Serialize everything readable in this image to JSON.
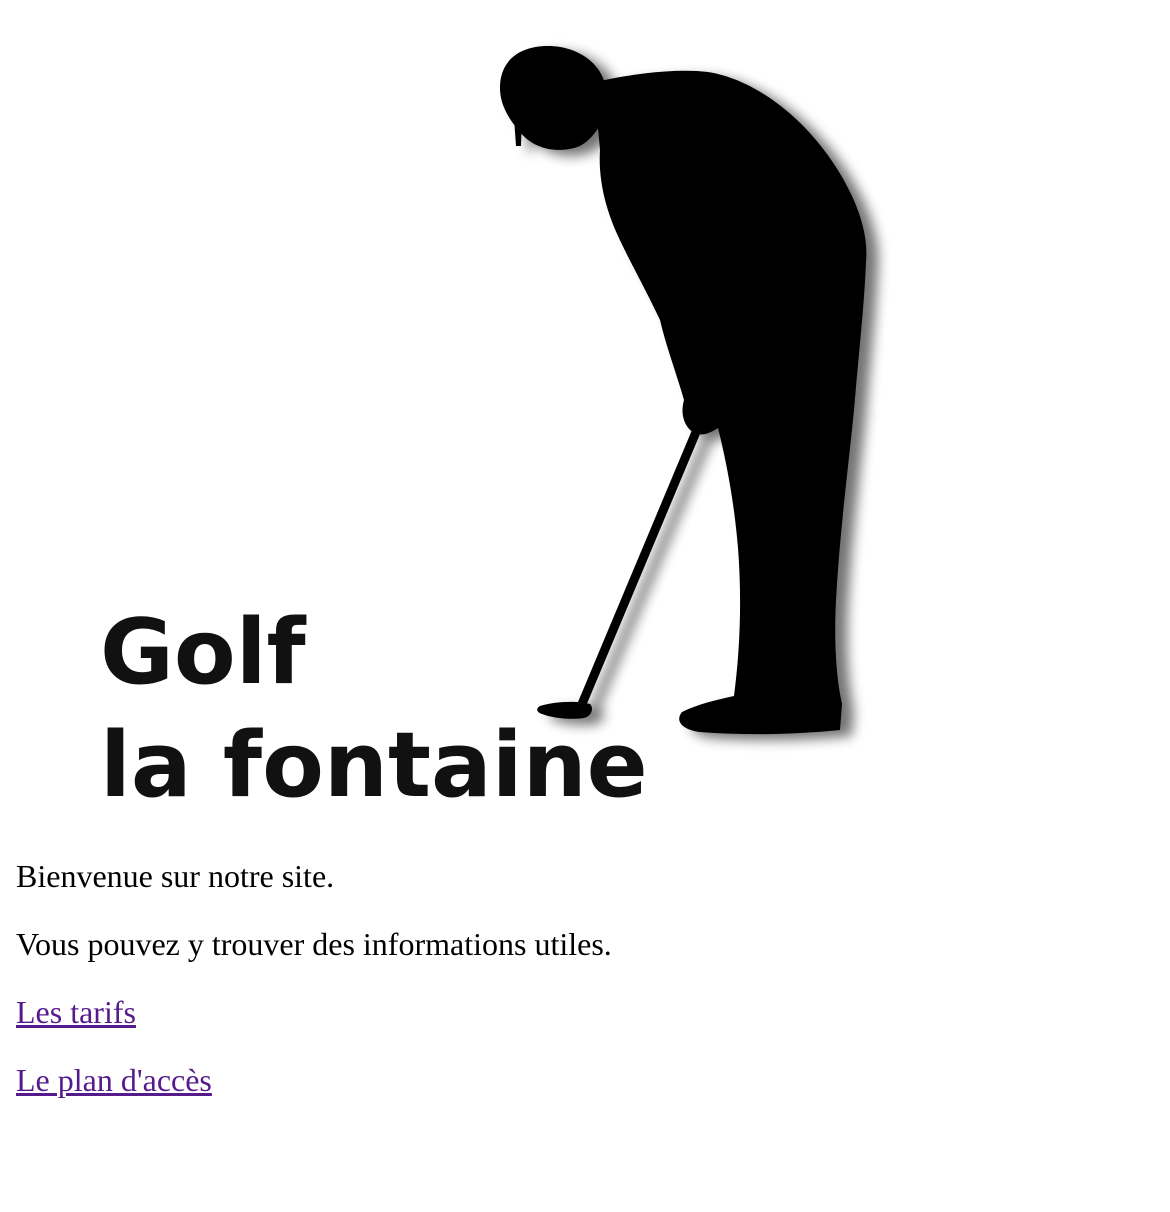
{
  "logo": {
    "line1": "Golf",
    "line2": "la fontaine",
    "icon": "golfer-putting-silhouette-icon",
    "color": "#000000"
  },
  "content": {
    "welcome": "Bienvenue sur notre site.",
    "info": "Vous pouvez y trouver des informations utiles.",
    "links": [
      {
        "label": "Les tarifs"
      },
      {
        "label": "Le plan d'accès"
      }
    ],
    "link_color": "#551a8b"
  }
}
